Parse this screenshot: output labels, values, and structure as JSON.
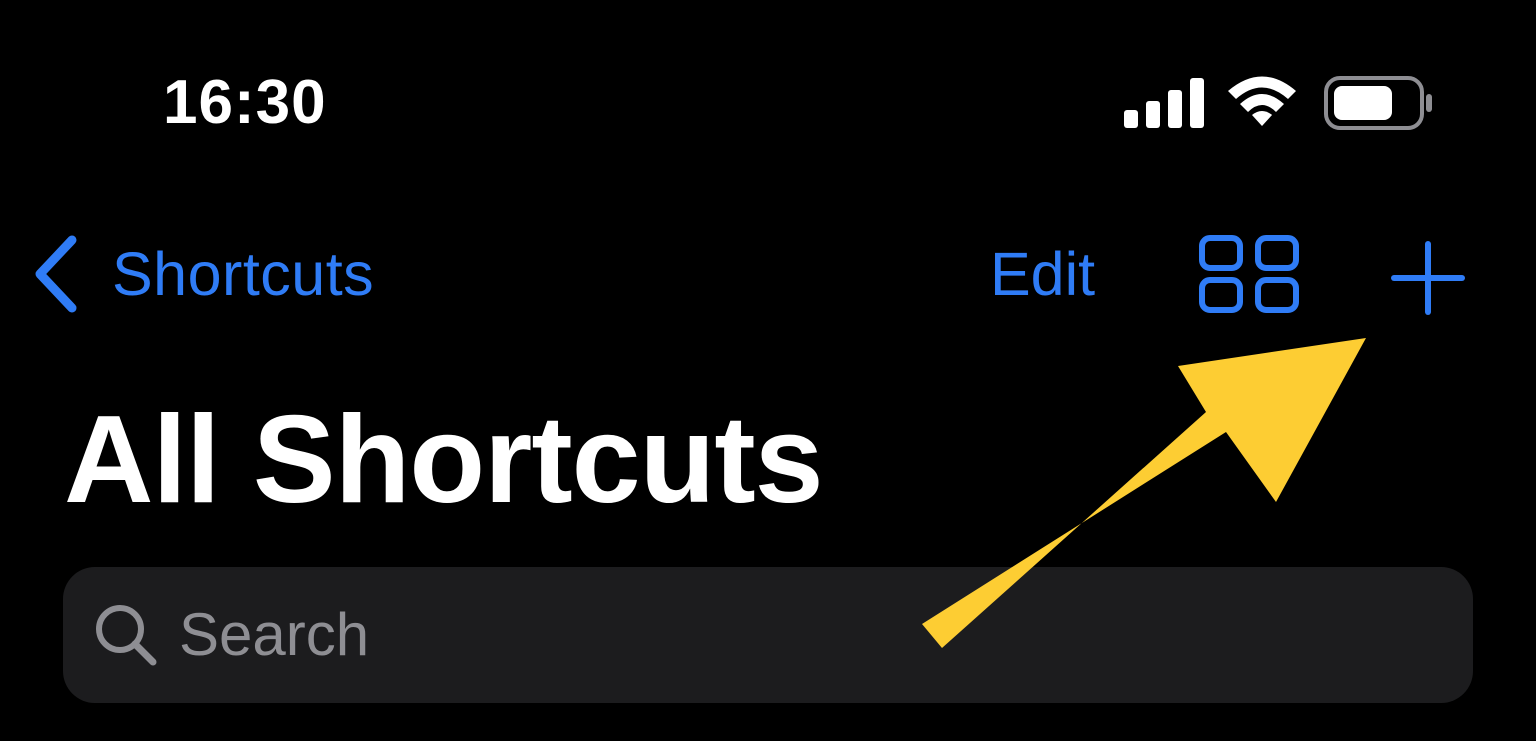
{
  "status_bar": {
    "time": "16:30",
    "icons": [
      "cellular-signal-icon",
      "wifi-icon",
      "battery-icon"
    ]
  },
  "nav_bar": {
    "back_label": "Shortcuts",
    "edit_label": "Edit",
    "grid_icon": "grid-view-icon",
    "add_icon": "plus-icon"
  },
  "main": {
    "title": "All Shortcuts"
  },
  "search": {
    "placeholder": "Search",
    "value": ""
  },
  "annotation": {
    "icon": "yellow-arrow-pointing-to-add",
    "color": "#fdcd33"
  },
  "colors": {
    "background": "#000000",
    "accent": "#2f7cf6",
    "search_bg": "#1c1c1e",
    "placeholder": "#8e8e93",
    "text": "#ffffff"
  }
}
